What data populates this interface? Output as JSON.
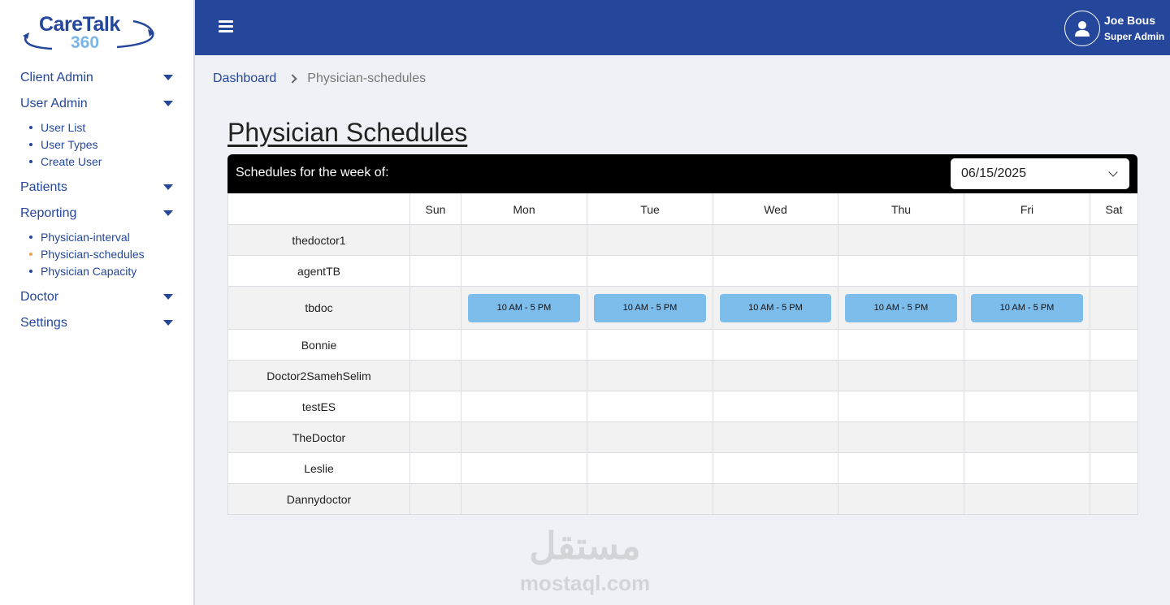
{
  "brand": {
    "name": "CareTalk",
    "number": "360"
  },
  "sidebar": {
    "sections": [
      {
        "label": "Client Admin",
        "items": []
      },
      {
        "label": "User Admin",
        "items": [
          "User List",
          "User Types",
          "Create User"
        ]
      },
      {
        "label": "Patients",
        "items": []
      },
      {
        "label": "Reporting",
        "items": [
          "Physician-interval",
          "Physician-schedules",
          "Physician Capacity"
        ]
      },
      {
        "label": "Doctor",
        "items": []
      },
      {
        "label": "Settings",
        "items": []
      }
    ],
    "active_item": "Physician-schedules"
  },
  "header": {
    "user_name": "Joe Bous",
    "user_role": "Super Admin"
  },
  "breadcrumb": {
    "home": "Dashboard",
    "current": "Physician-schedules"
  },
  "page_title": "Physician Schedules",
  "week": {
    "label": "Schedules for the week of:",
    "selected_date": "06/15/2025"
  },
  "table": {
    "days": [
      "Sun",
      "Mon",
      "Tue",
      "Wed",
      "Thu",
      "Fri",
      "Sat"
    ],
    "rows": [
      {
        "name": "thedoctor1",
        "slots": [
          "",
          "",
          "",
          "",
          "",
          "",
          ""
        ]
      },
      {
        "name": "agentTB",
        "slots": [
          "",
          "",
          "",
          "",
          "",
          "",
          ""
        ]
      },
      {
        "name": "tbdoc",
        "slots": [
          "",
          "10 AM - 5 PM",
          "10 AM - 5 PM",
          "10 AM - 5 PM",
          "10 AM - 5 PM",
          "10 AM - 5 PM",
          ""
        ]
      },
      {
        "name": "Bonnie",
        "slots": [
          "",
          "",
          "",
          "",
          "",
          "",
          ""
        ]
      },
      {
        "name": "Doctor2SamehSelim",
        "slots": [
          "",
          "",
          "",
          "",
          "",
          "",
          ""
        ]
      },
      {
        "name": "testES",
        "slots": [
          "",
          "",
          "",
          "",
          "",
          "",
          ""
        ]
      },
      {
        "name": "TheDoctor",
        "slots": [
          "",
          "",
          "",
          "",
          "",
          "",
          ""
        ]
      },
      {
        "name": "Leslie",
        "slots": [
          "",
          "",
          "",
          "",
          "",
          "",
          ""
        ]
      },
      {
        "name": "Dannydoctor",
        "slots": [
          "",
          "",
          "",
          "",
          "",
          "",
          ""
        ]
      }
    ]
  },
  "watermark": {
    "arabic": "مستقل",
    "latin": "mostaql.com"
  },
  "colors": {
    "primary": "#24479b",
    "slot": "#7dbdeb",
    "active_dot": "#f0a050",
    "background": "#f0f1f6"
  }
}
